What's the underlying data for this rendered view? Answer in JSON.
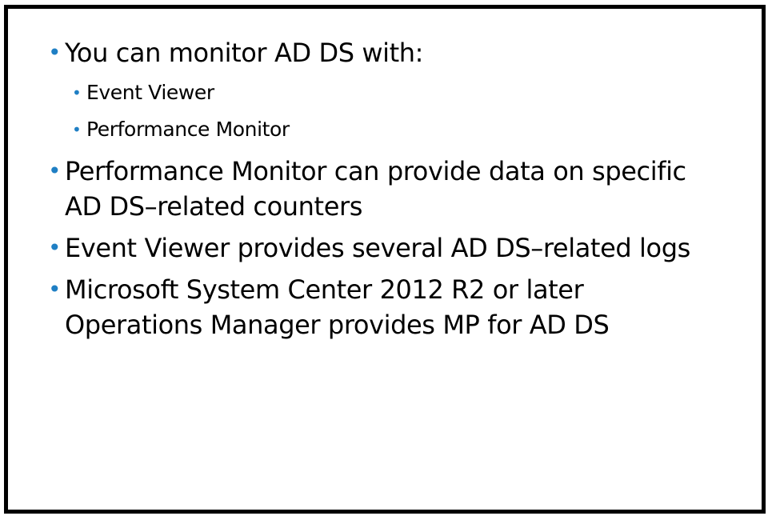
{
  "slide": {
    "bullets": [
      {
        "level": 1,
        "text": "You can monitor AD DS with:"
      },
      {
        "level": 2,
        "text": "Event Viewer"
      },
      {
        "level": 2,
        "text": "Performance Monitor"
      },
      {
        "level": 1,
        "text": "Performance Monitor can provide data on specific AD DS–related counters"
      },
      {
        "level": 1,
        "text": "Event Viewer provides several AD DS–related logs"
      },
      {
        "level": 1,
        "text": "Microsoft System Center 2012 R2 or later Operations Manager provides MP for AD DS"
      }
    ],
    "bullet_char": "•",
    "bullet_color": "#1f7fc4",
    "text_color": "#000000",
    "frame_color": "#000000"
  }
}
